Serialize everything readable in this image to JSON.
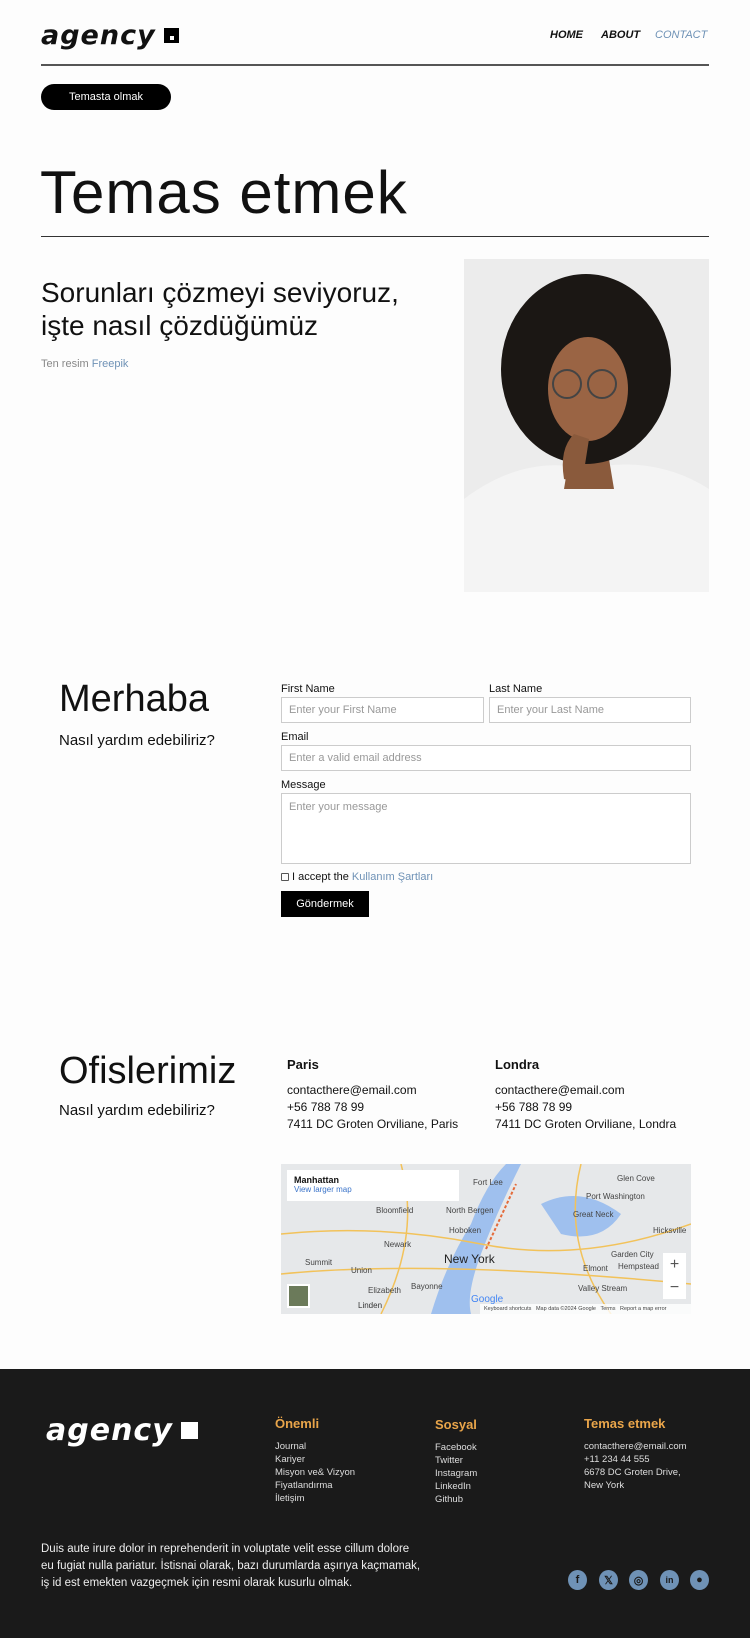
{
  "header": {
    "logo": "agency",
    "nav": [
      {
        "label": "HOME"
      },
      {
        "label": "ABOUT"
      },
      {
        "label": "CONTACT",
        "active": true
      }
    ],
    "pill_label": "Temasta olmak"
  },
  "hero": {
    "title": "Temas etmek",
    "subtitle_line1": "Sorunları çözmeyi seviyoruz,",
    "subtitle_line2": "işte nasıl çözdüğümüz",
    "credit_prefix": "Ten resim",
    "credit_link": "Freepik"
  },
  "contact": {
    "heading": "Merhaba",
    "subheading": "Nasıl yardım edebiliriz?",
    "first_name_label": "First Name",
    "first_name_placeholder": "Enter your First Name",
    "last_name_label": "Last Name",
    "last_name_placeholder": "Enter your Last Name",
    "email_label": "Email",
    "email_placeholder": "Enter a valid email address",
    "message_label": "Message",
    "message_placeholder": "Enter your message",
    "accept_prefix": "I accept the",
    "accept_link": "Kullanım Şartları",
    "submit": "Göndermek"
  },
  "offices": {
    "heading": "Ofislerimiz",
    "subheading": "Nasıl yardım edebiliriz?",
    "list": [
      {
        "city": "Paris",
        "email": "contacthere@email.com",
        "phone": "+56 788 78 99",
        "address": "7411 DC Groten Orviliane, Paris"
      },
      {
        "city": "Londra",
        "email": "contacthere@email.com",
        "phone": "+56 788 78 99",
        "address": "7411 DC Groten Orviliane, Londra"
      }
    ],
    "map": {
      "place": "Manhattan",
      "larger": "View larger map",
      "city_label": "New York",
      "labels": [
        "Newark",
        "Hoboken",
        "Bloomfield",
        "North Bergen",
        "Fort Lee",
        "Port Washington",
        "Great Neck",
        "Glen Cove",
        "Garden City",
        "Hempstead",
        "Elmont",
        "Valley Stream",
        "Hicksville",
        "Summit",
        "Union",
        "Elizabeth",
        "Bayonne",
        "Linden"
      ],
      "attrib": "Keyboard shortcuts   Map data ©2024 Google   Terms   Report a map error",
      "brand": "Google"
    }
  },
  "footer": {
    "logo": "agency",
    "col1": {
      "title": "Önemli",
      "items": [
        "Journal",
        "Kariyer",
        "Misyon ve& Vizyon",
        "Fiyatlandırma",
        "İletişim"
      ]
    },
    "col2": {
      "title": "Sosyal",
      "items": [
        "Facebook",
        "Twitter",
        "Instagram",
        "LinkedIn",
        "Github"
      ]
    },
    "col3": {
      "title": "Temas etmek",
      "items": [
        "contacthere@email.com",
        "+11 234 44 555",
        "6678 DC Groten Drive,",
        "New York"
      ]
    },
    "text_lines": [
      "Duis aute irure dolor in reprehenderit in voluptate velit esse cillum dolore",
      "eu fugiat nulla pariatur. İstisnai olarak, bazı durumlarda aşırıya kaçmamak,",
      "iş id est emekten vazgeçmek için resmi olarak kusurlu olmak."
    ],
    "social": [
      "facebook-icon",
      "x-icon",
      "instagram-icon",
      "linkedin-icon",
      "github-icon"
    ]
  },
  "colors": {
    "accent": "#6f92b6",
    "footer_bg": "#1a1a1a",
    "footer_heading": "#e9a54a"
  }
}
